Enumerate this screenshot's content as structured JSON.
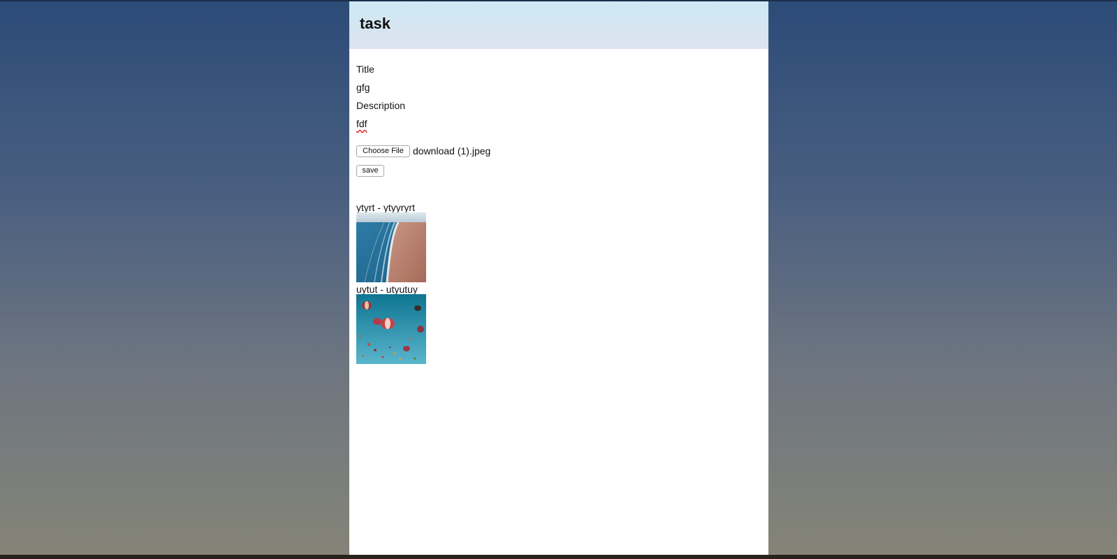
{
  "header": {
    "title": "task"
  },
  "form": {
    "title_label": "Title",
    "title_value": "gfg",
    "description_label": "Description",
    "description_value": "fdf",
    "choose_file_label": "Choose File",
    "file_name": "download (1).jpeg",
    "save_label": "save"
  },
  "tasks": [
    {
      "label": "ytyrt - ytyyryrt",
      "image": "beach-aerial-photo"
    },
    {
      "label": "uytut - utyutuy",
      "image": "hot-air-balloons-photo"
    }
  ]
}
